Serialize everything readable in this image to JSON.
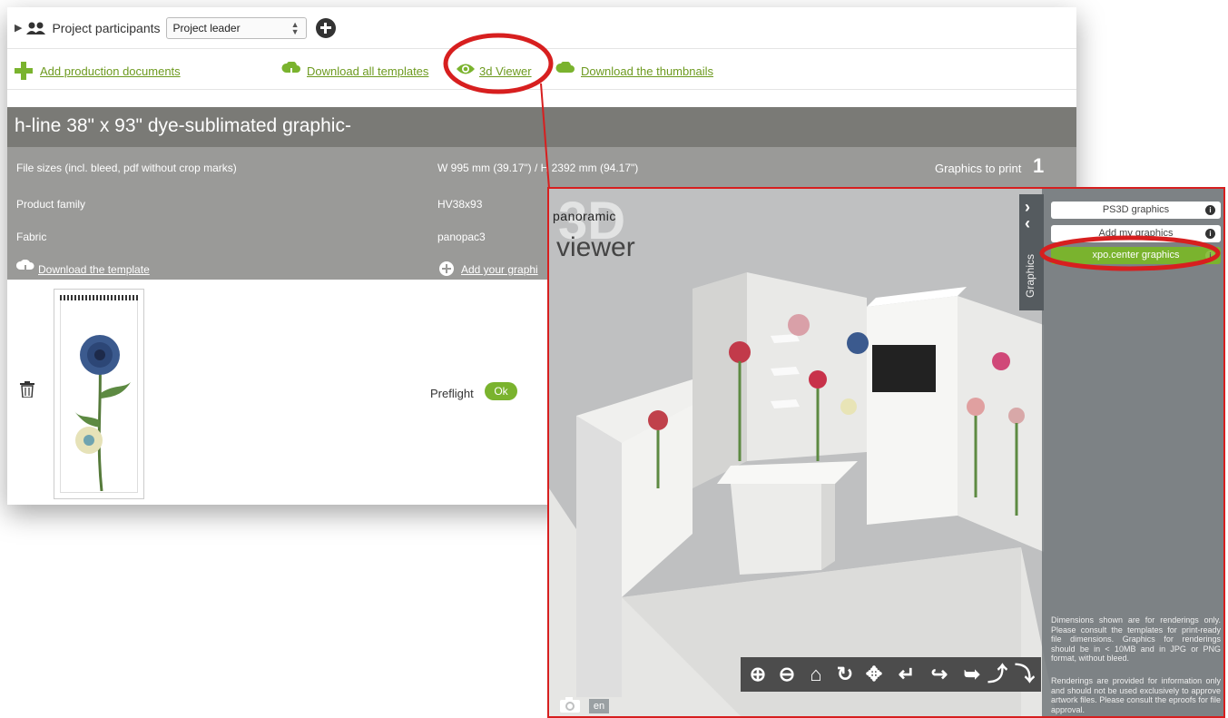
{
  "top_bar": {
    "participants_label": "Project participants",
    "role_select_value": "Project leader"
  },
  "action_links": {
    "add_production_documents": "Add production documents",
    "download_all_templates": "Download all templates",
    "viewer_3d": "3d Viewer",
    "download_thumbnails": "Download the thumbnails"
  },
  "product": {
    "title": "h-line 38\" x 93\" dye-sublimated graphic-",
    "file_sizes_label": "File sizes (incl. bleed, pdf without crop marks)",
    "file_sizes_value": "W 995 mm (39.17\") / H 2392 mm (94.17\")",
    "graphics_to_print_label": "Graphics to print",
    "graphics_to_print_value": "1",
    "product_family_label": "Product family",
    "product_family_value": "HV38x93",
    "fabric_label": "Fabric",
    "fabric_value": "panopac3",
    "download_template": "Download the template",
    "add_your_graphics": "Add your graphi"
  },
  "preflight": {
    "label": "Preflight",
    "status": "Ok"
  },
  "viewer": {
    "logo_small": "panoramic",
    "logo_3d": "3D",
    "logo_word": "viewer",
    "graphics_tab": "Graphics",
    "buttons": [
      "PS3D graphics",
      "Add my graphics",
      "xpo.center graphics"
    ],
    "notice_1": "Dimensions shown are for renderings only. Please consult the templates for print-ready file dimensions. Graphics for renderings should be in < 10MB and in JPG or PNG format, without bleed.",
    "notice_2": "Renderings are provided for information only and should not be used exclusively to approve artwork files. Please consult the eproofs for file approval.",
    "language": "en",
    "toolbar_icons": [
      "zoom-in-icon",
      "zoom-out-icon",
      "home-icon",
      "rotate-icon",
      "pan-icon",
      "undo-icon",
      "redo-icon",
      "up-icon",
      "down-icon"
    ]
  },
  "colors": {
    "accent_green": "#7ab32e",
    "link_green": "#6d9a1f",
    "title_bar": "#7a7a76",
    "info_box": "#9a9a98",
    "callout_red": "#d71f1f"
  }
}
